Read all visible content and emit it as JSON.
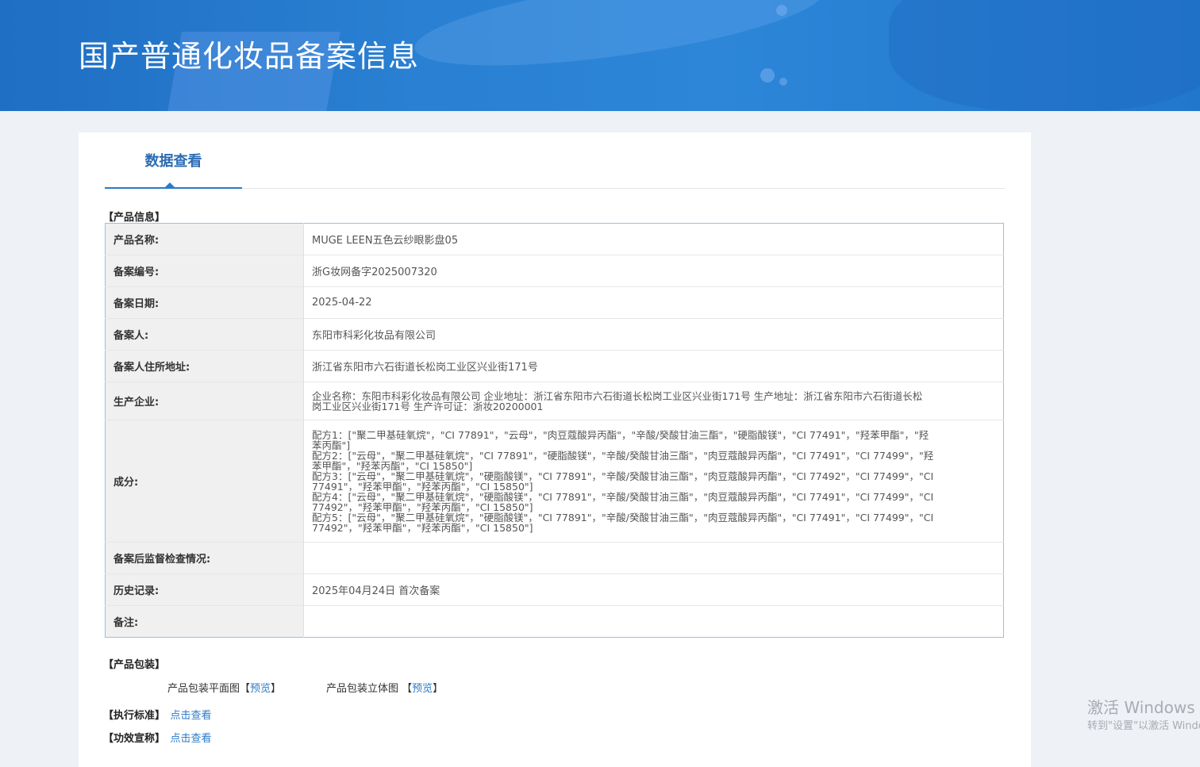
{
  "header": {
    "title": "国产普通化妆品备案信息"
  },
  "tabs": [
    {
      "label": "数据查看"
    }
  ],
  "product_info": {
    "section_title": "【产品信息】",
    "rows": [
      {
        "label": "产品名称:",
        "value": "MUGE LEEN五色云纱眼影盘05"
      },
      {
        "label": "备案编号:",
        "value": "浙G妆网备字2025007320"
      },
      {
        "label": "备案日期:",
        "value": "2025-04-22"
      },
      {
        "label": "备案人:",
        "value": "东阳市科彩化妆品有限公司"
      },
      {
        "label": "备案人住所地址:",
        "value": "浙江省东阳市六石街道长松岗工业区兴业街171号"
      },
      {
        "label": "生产企业:",
        "lines": [
          "企业名称：东阳市科彩化妆品有限公司 企业地址：浙江省东阳市六石街道长松岗工业区兴业街171号 生产地址：浙江省东阳市六石街道长松",
          "岗工业区兴业街171号 生产许可证：浙妆20200001"
        ]
      },
      {
        "label": "成分:",
        "lines": [
          "配方1：[\"聚二甲基硅氧烷\"，\"CI 77891\"，\"云母\"，\"肉豆蔻酸异丙酯\"，\"辛酸/癸酸甘油三酯\"，\"硬脂酸镁\"，\"CI 77491\"，\"羟苯甲酯\"，\"羟",
          "苯丙酯\"]",
          "配方2：[\"云母\"，\"聚二甲基硅氧烷\"，\"CI 77891\"，\"硬脂酸镁\"，\"辛酸/癸酸甘油三酯\"，\"肉豆蔻酸异丙酯\"，\"CI 77491\"，\"CI 77499\"，\"羟",
          "苯甲酯\"，\"羟苯丙酯\"，\"CI 15850\"]",
          "配方3：[\"云母\"，\"聚二甲基硅氧烷\"，\"硬脂酸镁\"，\"CI 77891\"，\"辛酸/癸酸甘油三酯\"，\"肉豆蔻酸异丙酯\"，\"CI 77492\"，\"CI 77499\"，\"CI",
          "77491\"，\"羟苯甲酯\"，\"羟苯丙酯\"，\"CI 15850\"]",
          "配方4：[\"云母\"，\"聚二甲基硅氧烷\"，\"硬脂酸镁\"，\"CI 77891\"，\"辛酸/癸酸甘油三酯\"，\"肉豆蔻酸异丙酯\"，\"CI 77491\"，\"CI 77499\"，\"CI",
          "77492\"，\"羟苯甲酯\"，\"羟苯丙酯\"，\"CI 15850\"]",
          "配方5：[\"云母\"，\"聚二甲基硅氧烷\"，\"硬脂酸镁\"，\"CI 77891\"，\"辛酸/癸酸甘油三酯\"，\"肉豆蔻酸异丙酯\"，\"CI 77491\"，\"CI 77499\"，\"CI",
          "77492\"，\"羟苯甲酯\"，\"羟苯丙酯\"，\"CI 15850\"]"
        ]
      },
      {
        "label": "备案后监督检查情况:",
        "value": ""
      },
      {
        "label": "历史记录:",
        "value": "2025年04月24日 首次备案"
      },
      {
        "label": "备注:",
        "value": ""
      }
    ]
  },
  "packaging": {
    "section_title": "【产品包装】",
    "flat_label": "产品包装平面图",
    "flat_bracket_open": "【",
    "flat_link": "预览",
    "flat_bracket_close": "】",
    "stereo_label": "产品包装立体图 ",
    "stereo_bracket_open": "【",
    "stereo_link": "预览",
    "stereo_bracket_close": "】"
  },
  "standard": {
    "title": "【执行标准】",
    "link": "点击查看"
  },
  "efficacy": {
    "title": "【功效宣称】",
    "link": "点击查看"
  },
  "watermark": {
    "line1": "激活 Windows",
    "line2": "转到\"设置\"以激活 Windows。"
  }
}
